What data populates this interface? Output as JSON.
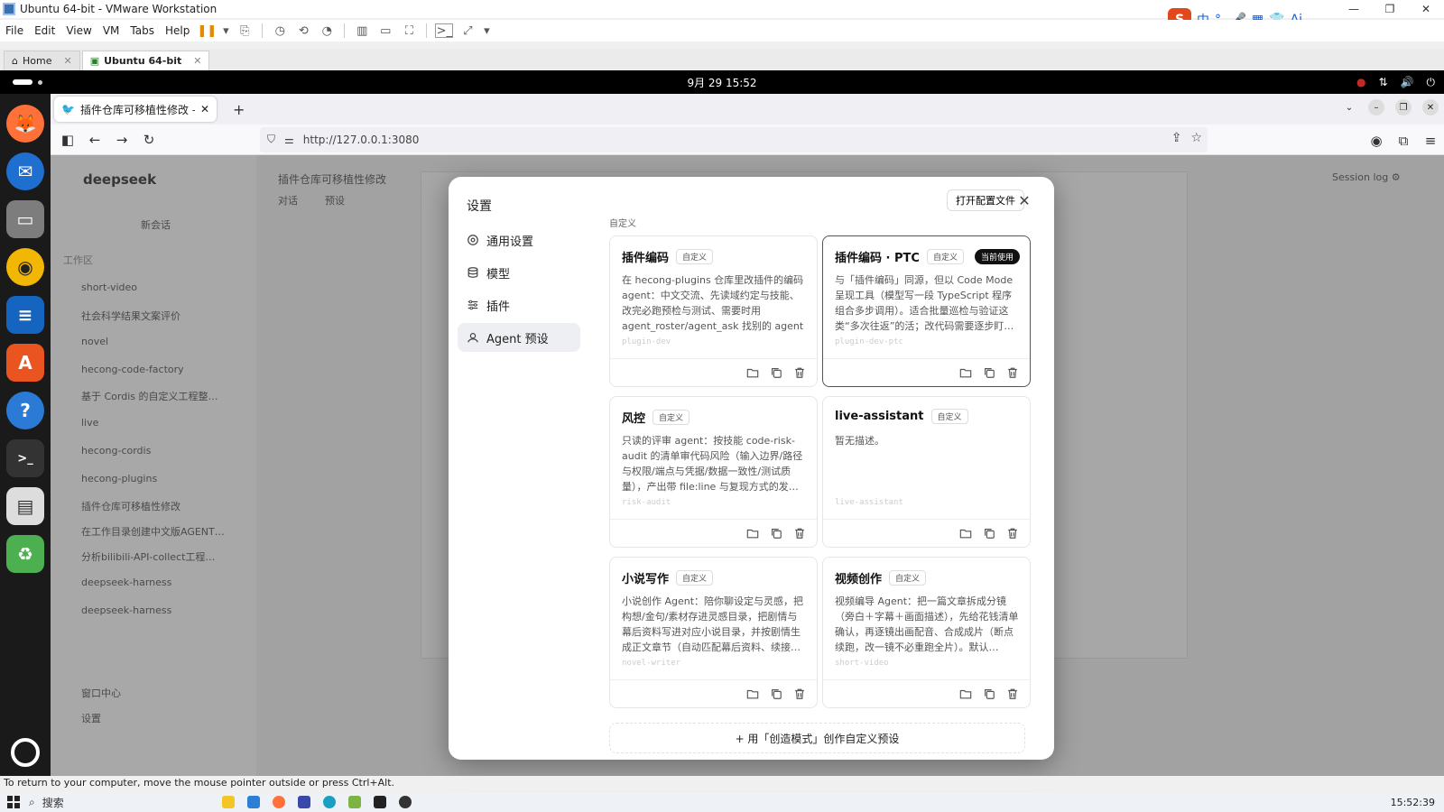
{
  "vmware": {
    "window_title": "Ubuntu 64-bit - VMware Workstation",
    "menu": [
      "File",
      "Edit",
      "View",
      "VM",
      "Tabs",
      "Help"
    ],
    "tabs": [
      {
        "label": "Home"
      },
      {
        "label": "Ubuntu 64-bit"
      }
    ],
    "hint": "To return to your computer, move the mouse pointer outside or press Ctrl+Alt."
  },
  "ime": {
    "label1": "中",
    "label2": "Ai"
  },
  "ubuntu": {
    "clock": "9月 29  15:52"
  },
  "firefox": {
    "tab_title": "插件仓库可移植性修改 —",
    "url": "http://127.0.0.1:3080"
  },
  "app_bg": {
    "brand": "deepseek",
    "new_chat": "新会话",
    "workspace_label": "工作区",
    "items": [
      "short-video",
      "社会科学结果文案评价",
      "novel",
      "hecong-code-factory",
      "基于 Cordis 的自定义工程整…",
      "live",
      "hecong-cordis",
      "hecong-plugins",
      "插件仓库可移植性修改",
      "在工作目录创建中文版AGENT…",
      "分析bilibili-API-collect工程…",
      "deepseek-harness",
      "deepseek-harness"
    ],
    "bottom": [
      "窗口中心",
      "设置"
    ],
    "header_title": "插件仓库可移植性修改",
    "header_tabs": [
      "对话",
      "预设"
    ],
    "session_log": "Session log ⚙"
  },
  "settings": {
    "title": "设置",
    "nav": [
      {
        "label": "通用设置"
      },
      {
        "label": "模型"
      },
      {
        "label": "插件"
      },
      {
        "label": "Agent 预设"
      }
    ],
    "open_config": "打开配置文件",
    "section": "自定义",
    "custom_badge": "自定义",
    "current_badge": "当前使用",
    "create_label": "+ 用「创造模式」创作自定义预设",
    "cards": [
      {
        "name": "插件编码",
        "desc": "在 hecong-plugins 仓库里改插件的编码 agent：中文交流、先读域约定与技能、改完必跑预检与测试、需要时用 agent_roster/agent_ask 找别的 agent …",
        "slug": "plugin-dev"
      },
      {
        "name": "插件编码 · PTC",
        "desc": "与「插件编码」同源，但以 Code Mode 呈现工具（模型写一段 TypeScript 程序组合多步调用）。适合批量巡检与验证这类“多次往返”的活；改代码需要逐步盯…",
        "slug": "plugin-dev-ptc"
      },
      {
        "name": "风控",
        "desc": "只读的评审 agent：按技能 code-risk-audit 的清单审代码风险（输入边界/路径与权限/端点与凭据/数据一致性/测试质量），产出带 file:line 与复现方式的发…",
        "slug": "risk-audit"
      },
      {
        "name": "live-assistant",
        "desc": "暂无描述。",
        "slug": "live-assistant"
      },
      {
        "name": "小说写作",
        "desc": "小说创作 Agent：陪你聊设定与灵感，把构想/金句/素材存进灵感目录，把剧情与幕后资料写进对应小说目录，并按剧情生成正文章节（自动匹配幕后资料、续接…",
        "slug": "novel-writer"
      },
      {
        "name": "视频创作",
        "desc": "视频编导 Agent：把一篇文章拆成分镜（旁白＋字幕＋画面描述），先给花钱清单确认，再逐镜出画配音、合成成片（断点续跑，改一镜不必重跑全片）。默认…",
        "slug": "short-video"
      }
    ]
  },
  "taskbar": {
    "search": "搜索",
    "time": "15:52:39"
  }
}
